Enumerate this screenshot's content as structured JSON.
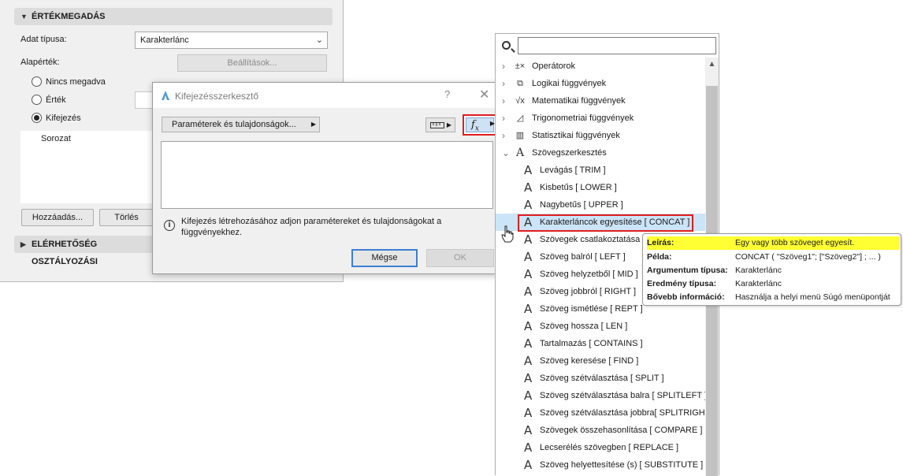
{
  "settings_panel": {
    "section_title": "ÉRTÉKMEGADÁS",
    "data_type_label": "Adat típusa:",
    "data_type_value": "Karakterlánc",
    "default_label": "Alapérték:",
    "settings_button": "Beállítások...",
    "radio_none": "Nincs megadva",
    "radio_value": "Érték",
    "radio_expression": "Kifejezés",
    "radio_selected": "Kifejezés",
    "list_item": "Sorozat",
    "add_button": "Hozzáadás...",
    "delete_button": "Törlés",
    "section2_title": "ELÉRHETŐSÉG OSZTÁLYOZÁSI"
  },
  "dialog": {
    "title": "Kifejezésszerkesztő",
    "help": "?",
    "close": "✕",
    "params_button": "Paraméterek és tulajdonságok...",
    "fx_label": "fx",
    "info_text": "Kifejezés létrehozásához adjon paramétereket és tulajdonságokat a függvényekhez.",
    "cancel_button": "Mégse",
    "ok_button": "OK"
  },
  "function_panel": {
    "search_placeholder": "",
    "categories": [
      {
        "label": "Operátorok",
        "icon": "operators-icon",
        "glyph": "±×",
        "expanded": false
      },
      {
        "label": "Logikai függvények",
        "icon": "puzzle-icon",
        "glyph": "⧉",
        "expanded": false
      },
      {
        "label": "Matematikai függvények",
        "icon": "sqrt-icon",
        "glyph": "√x",
        "expanded": false
      },
      {
        "label": "Trigonometriai függvények",
        "icon": "triangle-icon",
        "glyph": "◿",
        "expanded": false
      },
      {
        "label": "Statisztikai függvények",
        "icon": "chart-icon",
        "glyph": "▥",
        "expanded": false
      },
      {
        "label": "Szövegszerkesztés",
        "icon": "text-icon",
        "glyph": "A",
        "expanded": true
      }
    ],
    "functions": [
      "Levágás [ TRIM ]",
      "Kisbetűs [ LOWER ]",
      "Nagybetűs [ UPPER ]",
      "Karakterláncok egyesítése [ CONCAT ]",
      "Szövegek csatlakoztatása",
      "Szöveg balról [ LEFT ]",
      "Szöveg helyzetből [ MID ]",
      "Szöveg jobbról [ RIGHT ]",
      "Szöveg ismétlése [ REPT ]",
      "Szöveg hossza [ LEN ]",
      "Tartalmazás [ CONTAINS ]",
      "Szöveg keresése [ FIND ]",
      "Szöveg szétválasztása [ SPLIT ]",
      "Szöveg szétválasztása balra [ SPLITLEFT ]",
      "Szöveg szétválasztása jobbra[ SPLITRIGHT",
      "Szövegek összehasonlítása [ COMPARE ]",
      "Lecserélés szövegben [ REPLACE ]",
      "Szöveg helyettesítése (s) [ SUBSTITUTE ]"
    ],
    "selected_function": "Karakterláncok egyesítése [ CONCAT ]"
  },
  "tooltip": {
    "rows": [
      {
        "key": "Leírás:",
        "value": "Egy vagy több szöveget egyesít."
      },
      {
        "key": "Példa:",
        "value": "CONCAT ( \"Szöveg1\"; [\"Szöveg2\"] ; ... )"
      },
      {
        "key": "Argumentum típusa:",
        "value": "Karakterlánc"
      },
      {
        "key": "Eredmény típusa:",
        "value": "Karakterlánc"
      },
      {
        "key": "Bővebb információ:",
        "value": "Használja a helyi menü Súgó menüpontját"
      }
    ]
  },
  "colors": {
    "highlight_red": "#e01e1e",
    "selection_blue": "#cce4f7",
    "tooltip_highlight": "#ffff33"
  }
}
